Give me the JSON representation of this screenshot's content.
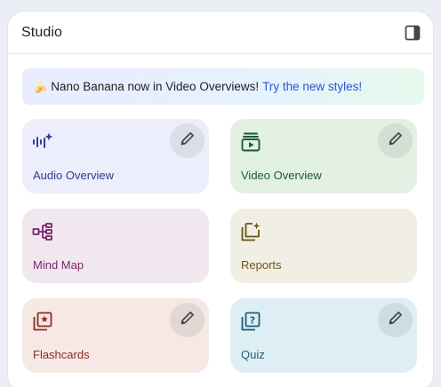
{
  "panel": {
    "title": "Studio",
    "toggle_icon": "sidebar-panel-icon"
  },
  "banner": {
    "emoji": "🍌",
    "text": "Nano Banana now in Video Overviews!",
    "link": "Try the new styles!"
  },
  "cards": [
    {
      "label": "Audio Overview",
      "icon": "audio-wave-sparkle-icon",
      "bg": "#eceefb",
      "color": "#2d3a8c",
      "editable": true
    },
    {
      "label": "Video Overview",
      "icon": "video-play-icon",
      "bg": "#e3f0e4",
      "color": "#1c5c2e",
      "editable": true
    },
    {
      "label": "Mind Map",
      "icon": "mind-map-icon",
      "bg": "#f1e8ef",
      "color": "#7a1f6c",
      "editable": false
    },
    {
      "label": "Reports",
      "icon": "reports-sparkle-icon",
      "bg": "#f1efe4",
      "color": "#6b5316",
      "editable": false
    },
    {
      "label": "Flashcards",
      "icon": "flashcards-icon",
      "bg": "#f5e8e5",
      "color": "#8a2e23",
      "editable": true
    },
    {
      "label": "Quiz",
      "icon": "quiz-icon",
      "bg": "#ddeff5",
      "color": "#1b5f78",
      "editable": true
    }
  ],
  "edit_icon": "pencil-icon"
}
